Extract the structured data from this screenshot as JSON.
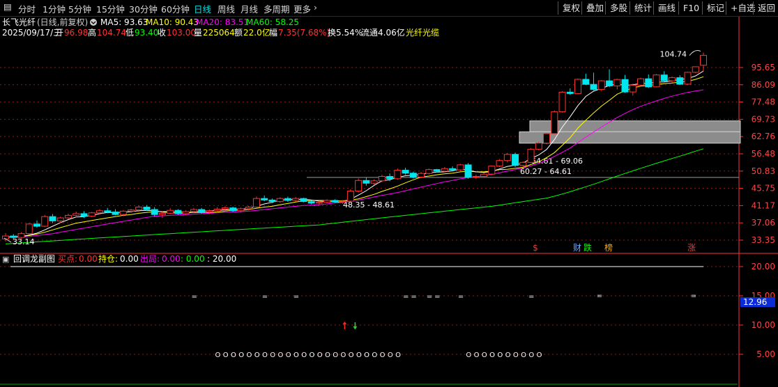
{
  "toolbar": {
    "left": [
      "分时",
      "1分钟",
      "5分钟",
      "15分钟",
      "30分钟",
      "60分钟",
      "日线",
      "周线",
      "月线",
      "多周期",
      "更多"
    ],
    "active": "日线",
    "right": [
      "复权",
      "叠加",
      "多股",
      "统计",
      "画线",
      "F10",
      "标记",
      "+自选",
      "返回"
    ]
  },
  "stock": {
    "name": "长飞光纤",
    "mode": "(日线,前复权)",
    "ma5": "MA5: 93.63",
    "ma10": "MA10: 90.43",
    "ma20": "MA20: 83.51",
    "ma60": "MA60: 58.25",
    "date": "2025/09/17/三",
    "open_label": "开",
    "open": "96.98",
    "high_label": "高",
    "high": "104.74",
    "low_label": "低",
    "low": "93.40",
    "close_label": "收",
    "close": "103.00",
    "vol_label": "量",
    "vol": "225064",
    "amount_label": "额",
    "amount": "22.0亿",
    "chg_label": "幅",
    "chg": "7.35(7.68%)",
    "turnover": "换5.54%",
    "float_cap": "流通4.06亿",
    "concept": "光纤光缆"
  },
  "colors": {
    "up": "#ff3333",
    "down": "#00e5ee",
    "ma5": "#ffffff",
    "ma10": "#ffff00",
    "ma20": "#ff00ff",
    "ma60": "#00ff00",
    "grid": "#8b1a1a",
    "axis": "#ff3333"
  },
  "price_axis": [
    "95.65",
    "86.09",
    "77.48",
    "69.73",
    "62.76",
    "56.48",
    "50.83",
    "45.75",
    "41.17",
    "37.06",
    "33.35"
  ],
  "labels": {
    "high_mark": "104.74",
    "low_mark": "33.14",
    "zone1": "64.61 - 69.06",
    "zone2": "60.27 - 64.61",
    "zone3": "48.35 - 48.61"
  },
  "events": [
    {
      "text": "$",
      "color": "#ff3333"
    },
    {
      "text": "财",
      "color": "#66aaff"
    },
    {
      "text": "跌",
      "color": "#00ff00"
    },
    {
      "text": "榜",
      "color": "#ffaa00"
    },
    {
      "text": "涨",
      "color": "#ff3333"
    }
  ],
  "indicator": {
    "name": "回调龙副图",
    "buy_label": "买点:",
    "buy": "0.00",
    "hold_label": "持仓:",
    "hold": "0.00",
    "exit_label": "出局:",
    "exit": "0.00",
    "extra1": ": 0.00",
    "extra2": ": 20.00",
    "axis": [
      "20.00",
      "15.00",
      "10.00",
      "5.00"
    ],
    "current": "12.96",
    "eq_marker": "=",
    "circle_marker": "O"
  },
  "chart_data": {
    "type": "candlestick",
    "ohlc": [
      [
        33.6,
        34.8,
        33.1,
        34.2
      ],
      [
        34.2,
        34.6,
        33.5,
        33.9
      ],
      [
        33.9,
        35.0,
        33.6,
        34.7
      ],
      [
        34.7,
        37.0,
        34.5,
        36.8
      ],
      [
        36.8,
        37.6,
        36.0,
        36.3
      ],
      [
        36.3,
        38.9,
        36.1,
        38.5
      ],
      [
        38.5,
        39.1,
        37.0,
        37.5
      ],
      [
        37.5,
        38.5,
        37.0,
        38.2
      ],
      [
        38.2,
        39.2,
        37.9,
        38.8
      ],
      [
        38.8,
        39.7,
        38.3,
        39.2
      ],
      [
        39.2,
        39.8,
        38.2,
        38.6
      ],
      [
        38.6,
        39.6,
        38.4,
        39.4
      ],
      [
        39.4,
        40.3,
        39.0,
        39.9
      ],
      [
        39.9,
        40.6,
        39.3,
        39.6
      ],
      [
        39.6,
        40.3,
        38.8,
        39.0
      ],
      [
        39.0,
        40.0,
        38.6,
        39.8
      ],
      [
        39.8,
        40.4,
        39.4,
        40.1
      ],
      [
        40.1,
        41.2,
        39.6,
        40.8
      ],
      [
        40.8,
        41.3,
        39.9,
        40.2
      ],
      [
        40.2,
        40.8,
        38.5,
        39.0
      ],
      [
        39.0,
        39.8,
        38.2,
        39.3
      ],
      [
        39.3,
        40.5,
        39.1,
        40.0
      ],
      [
        40.0,
        40.3,
        38.9,
        39.2
      ],
      [
        39.2,
        40.0,
        38.8,
        39.7
      ],
      [
        39.7,
        40.6,
        39.3,
        40.2
      ],
      [
        40.2,
        40.6,
        39.2,
        39.6
      ],
      [
        39.6,
        40.2,
        39.1,
        39.9
      ],
      [
        39.9,
        40.8,
        39.4,
        40.3
      ],
      [
        40.3,
        41.0,
        39.8,
        40.6
      ],
      [
        40.6,
        40.9,
        39.6,
        39.9
      ],
      [
        39.9,
        40.7,
        39.5,
        40.4
      ],
      [
        40.4,
        41.1,
        40.0,
        40.8
      ],
      [
        40.8,
        43.5,
        40.6,
        43.0
      ],
      [
        43.0,
        43.8,
        42.3,
        42.6
      ],
      [
        42.6,
        43.0,
        41.8,
        42.2
      ],
      [
        42.2,
        43.3,
        41.9,
        43.0
      ],
      [
        43.0,
        43.5,
        42.1,
        42.5
      ],
      [
        42.5,
        43.4,
        42.2,
        43.0
      ],
      [
        43.0,
        43.2,
        42.0,
        42.2
      ],
      [
        42.2,
        42.5,
        41.5,
        41.8
      ],
      [
        41.8,
        42.4,
        41.3,
        42.0
      ],
      [
        42.0,
        42.8,
        41.8,
        42.5
      ],
      [
        42.5,
        42.8,
        41.9,
        42.1
      ],
      [
        42.1,
        42.6,
        41.6,
        42.3
      ],
      [
        42.3,
        45.5,
        42.1,
        45.0
      ],
      [
        45.0,
        48.6,
        44.6,
        48.0
      ],
      [
        48.0,
        48.9,
        46.5,
        47.2
      ],
      [
        47.2,
        48.3,
        46.8,
        47.9
      ],
      [
        47.9,
        49.7,
        47.5,
        49.2
      ],
      [
        49.2,
        50.1,
        47.8,
        48.5
      ],
      [
        48.5,
        51.6,
        48.2,
        51.1
      ],
      [
        51.1,
        51.9,
        49.7,
        50.2
      ],
      [
        50.2,
        50.7,
        48.6,
        49.0
      ],
      [
        49.0,
        50.6,
        48.7,
        50.1
      ],
      [
        50.1,
        51.6,
        49.8,
        51.3
      ],
      [
        51.3,
        51.5,
        50.4,
        50.8
      ],
      [
        50.8,
        52.1,
        50.4,
        51.6
      ],
      [
        51.6,
        52.3,
        50.9,
        51.2
      ],
      [
        51.2,
        53.1,
        50.9,
        52.8
      ],
      [
        52.8,
        53.4,
        48.5,
        49.0
      ],
      [
        49.0,
        49.7,
        48.5,
        49.2
      ],
      [
        49.2,
        50.3,
        48.9,
        49.9
      ],
      [
        49.9,
        52.6,
        49.6,
        52.4
      ],
      [
        52.4,
        54.7,
        52.1,
        54.2
      ],
      [
        54.2,
        56.8,
        53.6,
        56.3
      ],
      [
        56.3,
        56.9,
        52.1,
        52.6
      ],
      [
        52.6,
        53.9,
        52.2,
        53.6
      ],
      [
        53.6,
        58.5,
        53.4,
        58.1
      ],
      [
        58.1,
        60.9,
        57.7,
        60.3
      ],
      [
        60.3,
        64.2,
        59.9,
        63.9
      ],
      [
        63.9,
        73.6,
        63.6,
        73.0
      ],
      [
        73.0,
        82.8,
        72.6,
        82.3
      ],
      [
        82.3,
        84.2,
        80.9,
        81.6
      ],
      [
        81.6,
        89.4,
        81.3,
        89.0
      ],
      [
        89.0,
        92.1,
        85.9,
        86.3
      ],
      [
        86.3,
        92.7,
        83.2,
        83.7
      ],
      [
        83.7,
        88.6,
        82.9,
        88.2
      ],
      [
        88.2,
        94.6,
        84.8,
        85.5
      ],
      [
        85.5,
        89.3,
        83.7,
        88.9
      ],
      [
        88.9,
        91.4,
        81.9,
        82.4
      ],
      [
        82.4,
        86.7,
        80.6,
        85.9
      ],
      [
        85.9,
        89.9,
        85.4,
        89.3
      ],
      [
        89.3,
        91.7,
        84.4,
        85.0
      ],
      [
        85.0,
        91.9,
        84.7,
        91.4
      ],
      [
        91.4,
        93.5,
        87.8,
        88.2
      ],
      [
        88.2,
        90.6,
        87.2,
        89.9
      ],
      [
        89.9,
        91.2,
        85.9,
        86.4
      ],
      [
        86.4,
        93.2,
        85.9,
        92.9
      ],
      [
        92.9,
        95.6,
        92.4,
        96.1
      ],
      [
        96.98,
        104.74,
        93.4,
        103.0
      ]
    ],
    "ma5": [
      34.0,
      34.0,
      34.1,
      34.4,
      34.8,
      35.5,
      36.3,
      37.1,
      37.8,
      38.4,
      38.5,
      38.8,
      39.2,
      39.5,
      39.5,
      39.5,
      39.7,
      39.9,
      40.0,
      39.9,
      39.6,
      39.5,
      39.3,
      39.3,
      39.6,
      39.8,
      39.9,
      40.0,
      40.1,
      40.2,
      40.3,
      40.5,
      41.0,
      41.6,
      42.0,
      42.6,
      42.7,
      42.7,
      42.8,
      42.6,
      42.3,
      42.2,
      42.1,
      42.1,
      42.8,
      43.9,
      45.1,
      46.6,
      47.9,
      48.2,
      48.9,
      49.4,
      49.6,
      49.8,
      50.3,
      50.5,
      50.6,
      50.9,
      51.5,
      51.1,
      50.6,
      50.4,
      50.7,
      51.5,
      52.3,
      52.7,
      53.4,
      54.9,
      56.1,
      58.0,
      61.6,
      66.5,
      70.8,
      75.8,
      80.2,
      82.8,
      84.2,
      85.7,
      86.5,
      85.8,
      86.1,
      86.8,
      86.9,
      87.5,
      87.6,
      88.2,
      88.9,
      89.4,
      90.9,
      93.6
    ],
    "ma10": [
      34.0,
      34.0,
      34.1,
      34.3,
      34.6,
      35.0,
      35.5,
      36.0,
      36.5,
      37.0,
      37.3,
      37.6,
      37.9,
      38.2,
      38.5,
      38.8,
      39.0,
      39.3,
      39.5,
      39.7,
      39.7,
      39.7,
      39.6,
      39.6,
      39.5,
      39.5,
      39.5,
      39.6,
      39.8,
      40.0,
      40.0,
      40.2,
      40.5,
      40.8,
      41.0,
      41.4,
      41.7,
      42.1,
      42.4,
      42.5,
      42.5,
      42.5,
      42.4,
      42.4,
      42.6,
      42.9,
      43.5,
      44.1,
      44.9,
      45.6,
      46.4,
      47.3,
      48.2,
      49.0,
      49.3,
      49.7,
      50.0,
      50.2,
      50.6,
      50.8,
      50.6,
      50.6,
      50.8,
      51.3,
      51.4,
      51.7,
      52.0,
      52.9,
      53.8,
      55.2,
      56.9,
      59.5,
      62.3,
      66.1,
      69.3,
      72.5,
      75.6,
      78.3,
      81.3,
      83.0,
      84.5,
      85.4,
      85.8,
      86.2,
      86.7,
      87.0,
      87.5,
      87.9,
      89.0,
      90.4
    ],
    "ma20": [
      34.0,
      34.0,
      34.0,
      34.1,
      34.3,
      34.5,
      34.7,
      35.0,
      35.3,
      35.6,
      35.9,
      36.2,
      36.5,
      36.8,
      37.1,
      37.4,
      37.7,
      38.0,
      38.3,
      38.6,
      38.7,
      38.8,
      38.9,
      39.0,
      39.1,
      39.2,
      39.3,
      39.4,
      39.5,
      39.6,
      39.7,
      39.8,
      40.0,
      40.2,
      40.4,
      40.6,
      40.8,
      41.0,
      41.2,
      41.3,
      41.4,
      41.6,
      41.8,
      42.0,
      42.3,
      42.6,
      43.0,
      43.4,
      43.8,
      44.2,
      44.6,
      45.1,
      45.6,
      46.1,
      46.6,
      47.1,
      47.6,
      48.0,
      48.5,
      48.8,
      49.1,
      49.4,
      49.8,
      50.3,
      50.8,
      51.3,
      51.8,
      52.5,
      53.3,
      54.3,
      55.6,
      57.0,
      58.5,
      60.5,
      62.5,
      64.5,
      66.5,
      68.5,
      70.5,
      72.3,
      74.0,
      75.5,
      76.8,
      78.0,
      79.2,
      80.3,
      81.3,
      82.2,
      82.9,
      83.5
    ],
    "ma60": [
      32.6,
      32.7,
      32.8,
      32.9,
      33.0,
      33.1,
      33.2,
      33.3,
      33.4,
      33.5,
      33.6,
      33.7,
      33.8,
      33.9,
      34.0,
      34.1,
      34.2,
      34.3,
      34.4,
      34.5,
      34.6,
      34.7,
      34.8,
      34.9,
      35.0,
      35.1,
      35.2,
      35.3,
      35.4,
      35.5,
      35.6,
      35.7,
      35.8,
      35.9,
      36.0,
      36.1,
      36.2,
      36.3,
      36.4,
      36.5,
      36.6,
      36.8,
      37.0,
      37.2,
      37.4,
      37.6,
      37.8,
      38.0,
      38.2,
      38.4,
      38.6,
      38.8,
      39.0,
      39.2,
      39.4,
      39.6,
      39.8,
      40.0,
      40.2,
      40.4,
      40.6,
      40.8,
      41.0,
      41.3,
      41.6,
      41.9,
      42.2,
      42.5,
      42.8,
      43.1,
      43.6,
      44.2,
      44.8,
      45.5,
      46.2,
      46.9,
      47.7,
      48.5,
      49.3,
      50.1,
      50.9,
      51.7,
      52.5,
      53.3,
      54.1,
      54.9,
      55.7,
      56.5,
      57.4,
      58.25
    ],
    "resistance_y": 48.9,
    "zones": [
      {
        "lo": 64.61,
        "hi": 69.06
      },
      {
        "lo": 60.27,
        "hi": 64.61
      }
    ],
    "eq_days": [
      23,
      32,
      36,
      50,
      51,
      53,
      54,
      57,
      66
    ],
    "circle_days": [
      26,
      27,
      28,
      29,
      30,
      31,
      32,
      33,
      34,
      35,
      36,
      37,
      38,
      39,
      40,
      41,
      42,
      43,
      44,
      45,
      46,
      47,
      48,
      49,
      58,
      59,
      60,
      61,
      62,
      63,
      64,
      65,
      66,
      67
    ],
    "arrow_day": 42
  }
}
